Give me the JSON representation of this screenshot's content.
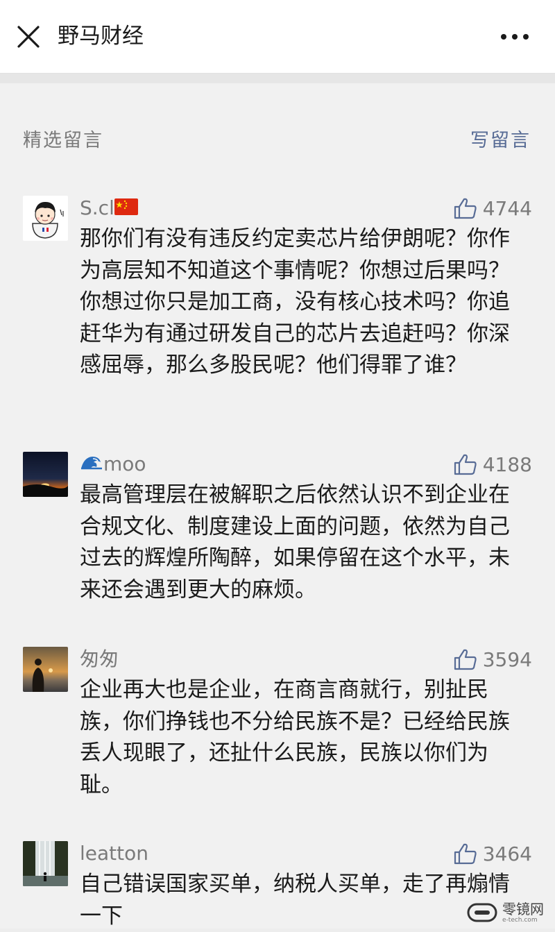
{
  "header": {
    "title": "野马财经"
  },
  "section": {
    "title": "精选留言",
    "write_label": "写留言"
  },
  "comments": [
    {
      "nickname": "S.cl",
      "nickname_emoji": "china-flag",
      "likes": "4744",
      "text": "那你们有没有违反约定卖芯片给伊朗呢？你作为高层知不知道这个事情呢？你想过后果吗？你想过你只是加工商，没有核心技术吗？你追赶华为有通过研发自己的芯片去追赶吗？你深感屈辱，那么多股民呢？他们得罪了谁？"
    },
    {
      "nickname": "moo",
      "nickname_emoji": "wave",
      "likes": "4188",
      "text": "最高管理层在被解职之后依然认识不到企业在合规文化、制度建设上面的问题，依然为自己过去的辉煌所陶醉，如果停留在这个水平，未来还会遇到更大的麻烦。"
    },
    {
      "nickname": "匆匆",
      "likes": "3594",
      "text": "企业再大也是企业，在商言商就行，别扯民族，你们挣钱也不分给民族不是？已经给民族丢人现眼了，还扯什么民族，民族以你们为耻。"
    },
    {
      "nickname": "leatton",
      "likes": "3464",
      "text": "自己错误国家买单，纳税人买单，走了再煽情一下"
    }
  ],
  "watermark": {
    "main": "零镜网",
    "sub": "e-tech.com"
  },
  "colors": {
    "link": "#576b95",
    "meta": "#7a7a7a",
    "text": "#1a1a1a",
    "background": "#f1f1f1"
  }
}
